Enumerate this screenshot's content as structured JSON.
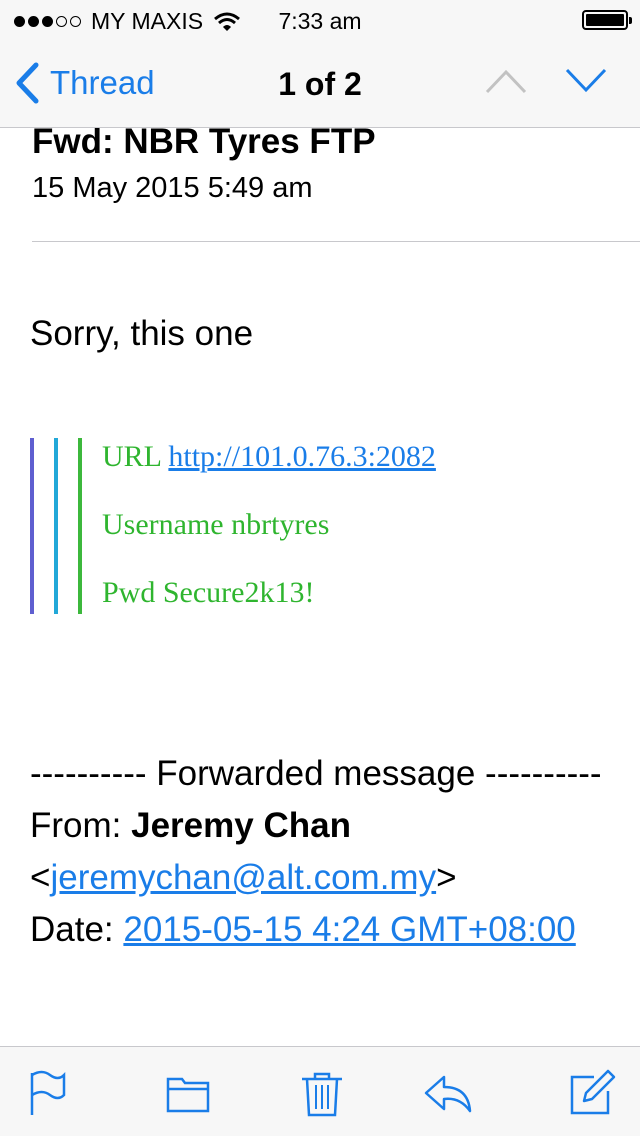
{
  "status_bar": {
    "carrier": "MY MAXIS",
    "time": "7:33 am",
    "signal_bars": 3,
    "signal_total": 5,
    "battery_level": 1.0
  },
  "nav": {
    "back_label": "Thread",
    "title": "1 of 2",
    "icons": [
      "chevron-left-icon",
      "chevron-up-icon",
      "chevron-down-icon"
    ]
  },
  "message": {
    "subject": "Fwd: NBR Tyres FTP",
    "date": "15 May 2015 5:49 am",
    "body": "Sorry, this one",
    "quote": {
      "url_label": "URL",
      "url": "http://101.0.76.3:2082",
      "username_line": "Username nbrtyres",
      "password_line": "Pwd Secure2k13!"
    },
    "forwarded": {
      "header": "---------- Forwarded message ----------",
      "from_label": "From:",
      "from_name": "Jeremy Chan",
      "from_email": "jeremychan@alt.com.my",
      "date_label": "Date:",
      "date_value": "2015-05-15 4:24 GMT+08:00"
    }
  },
  "toolbar": {
    "icons": [
      "flag-icon",
      "folder-icon",
      "trash-icon",
      "reply-icon",
      "compose-icon"
    ]
  },
  "colors": {
    "accent": "#1a7de8",
    "quote_text": "#2fb52f",
    "quote_bars": [
      "#5f5fd0",
      "#22a8d8",
      "#3cb83c"
    ],
    "bar_background": "#f7f7f7"
  }
}
